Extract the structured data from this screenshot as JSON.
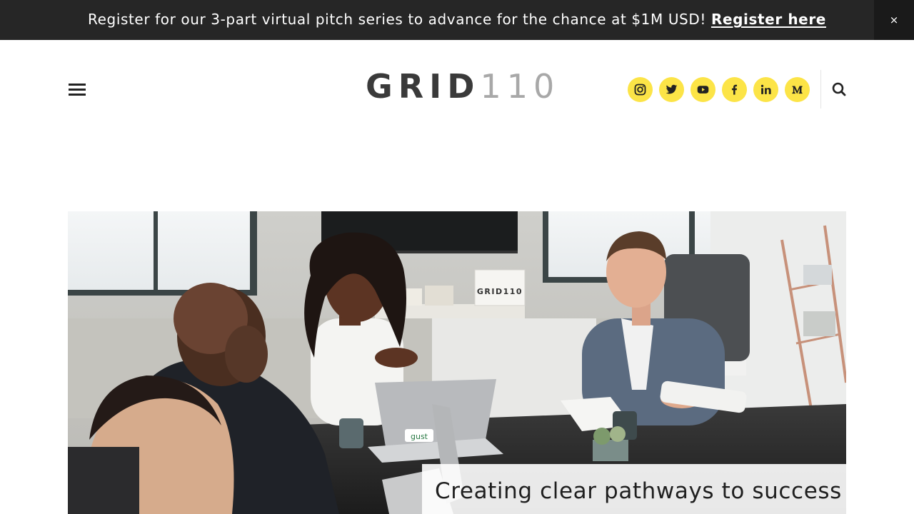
{
  "announcement": {
    "text": "Register for our 3-part virtual pitch series to advance for the chance at $1M USD!",
    "link_label": "Register here",
    "close_label": "×"
  },
  "header": {
    "logo_primary": "GRID",
    "logo_secondary": "110",
    "social_icons": [
      "instagram-icon",
      "twitter-icon",
      "youtube-icon",
      "facebook-icon",
      "linkedin-icon",
      "medium-icon"
    ],
    "accent_color": "#fce447"
  },
  "hero": {
    "sign_text": "GRID110",
    "laptop_sticker": "gust",
    "caption": "Creating clear pathways to success"
  }
}
